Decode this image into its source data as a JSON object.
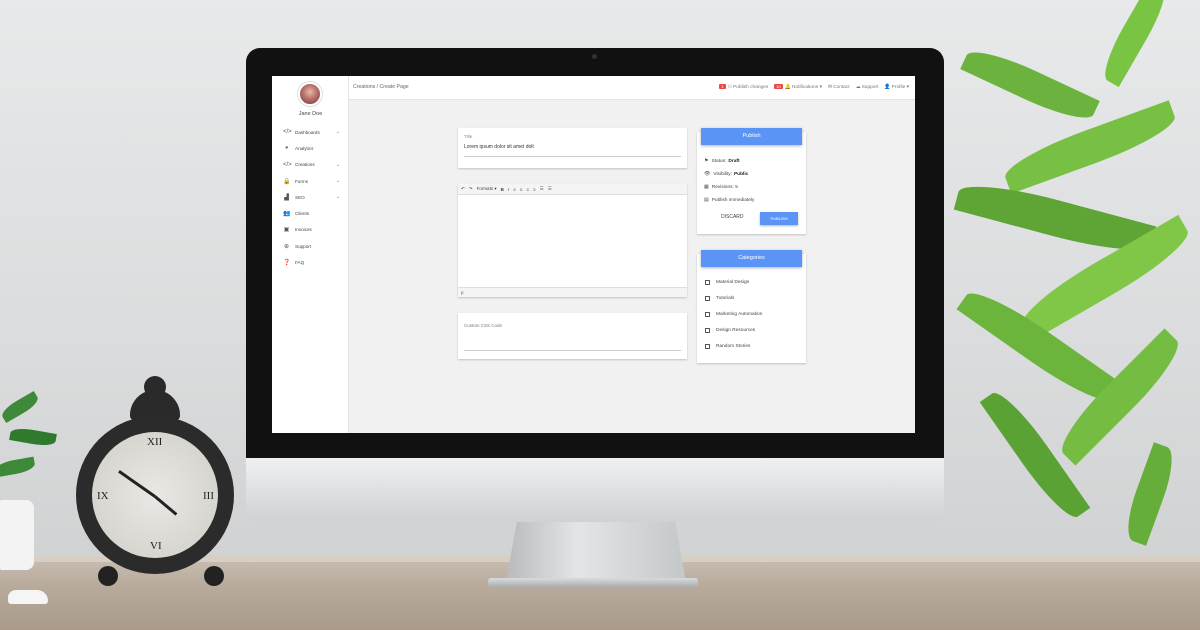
{
  "sidebar": {
    "user_name": "Jane Doe",
    "items": [
      {
        "label": "Dashboards",
        "icon": "code-icon",
        "glyph": "</>",
        "expandable": true
      },
      {
        "label": "Analytics",
        "icon": "pie-chart-icon",
        "glyph": "◕",
        "expandable": false
      },
      {
        "label": "Creations",
        "icon": "code-icon",
        "glyph": "</>",
        "expandable": true
      },
      {
        "label": "Forms",
        "icon": "lock-icon",
        "glyph": "🔒",
        "expandable": true
      },
      {
        "label": "SEO",
        "icon": "bar-chart-icon",
        "glyph": "▟",
        "expandable": true
      },
      {
        "label": "Clients",
        "icon": "users-icon",
        "glyph": "👥",
        "expandable": false
      },
      {
        "label": "Invoices",
        "icon": "invoice-icon",
        "glyph": "▣",
        "expandable": false
      },
      {
        "label": "Support",
        "icon": "lifebuoy-icon",
        "glyph": "⊕",
        "expandable": false
      },
      {
        "label": "FAQ",
        "icon": "question-icon",
        "glyph": "❓",
        "expandable": false
      }
    ]
  },
  "topbar": {
    "breadcrumb": "Creations / Create Page",
    "publish_badge": "1",
    "publish_label": "Publish changes",
    "notifications_badge": "10",
    "notifications_label": "Notifications ▾",
    "contact_label": "Contact",
    "support_label": "Support",
    "profile_label": "Profile ▾"
  },
  "editor": {
    "title_label": "Title",
    "title_value": "Lorem ipsum dolor sit amet dolt",
    "toolbar": [
      "↶",
      "↷",
      "Formats ▾",
      "B",
      "I",
      "≡",
      "≡",
      "≡",
      "≡",
      "☰",
      "☰"
    ],
    "status_path": "p",
    "css_label": "Custom CSS Code"
  },
  "publish": {
    "header": "Publish",
    "status_label": "Status:",
    "status_value": "Draft",
    "visibility_label": "Visibility:",
    "visibility_value": "Public",
    "revisions_label": "Revisions: 5",
    "schedule_label": "Publish immediately",
    "discard_label": "DISCARD",
    "publish_button": "PUBLISH"
  },
  "categories": {
    "header": "Categories",
    "items": [
      "Material Design",
      "Tutorials",
      "Marketing Automation",
      "Design Resources",
      "Random Stories"
    ]
  },
  "colors": {
    "accent": "#5a95f5",
    "badge": "#e94a47"
  }
}
